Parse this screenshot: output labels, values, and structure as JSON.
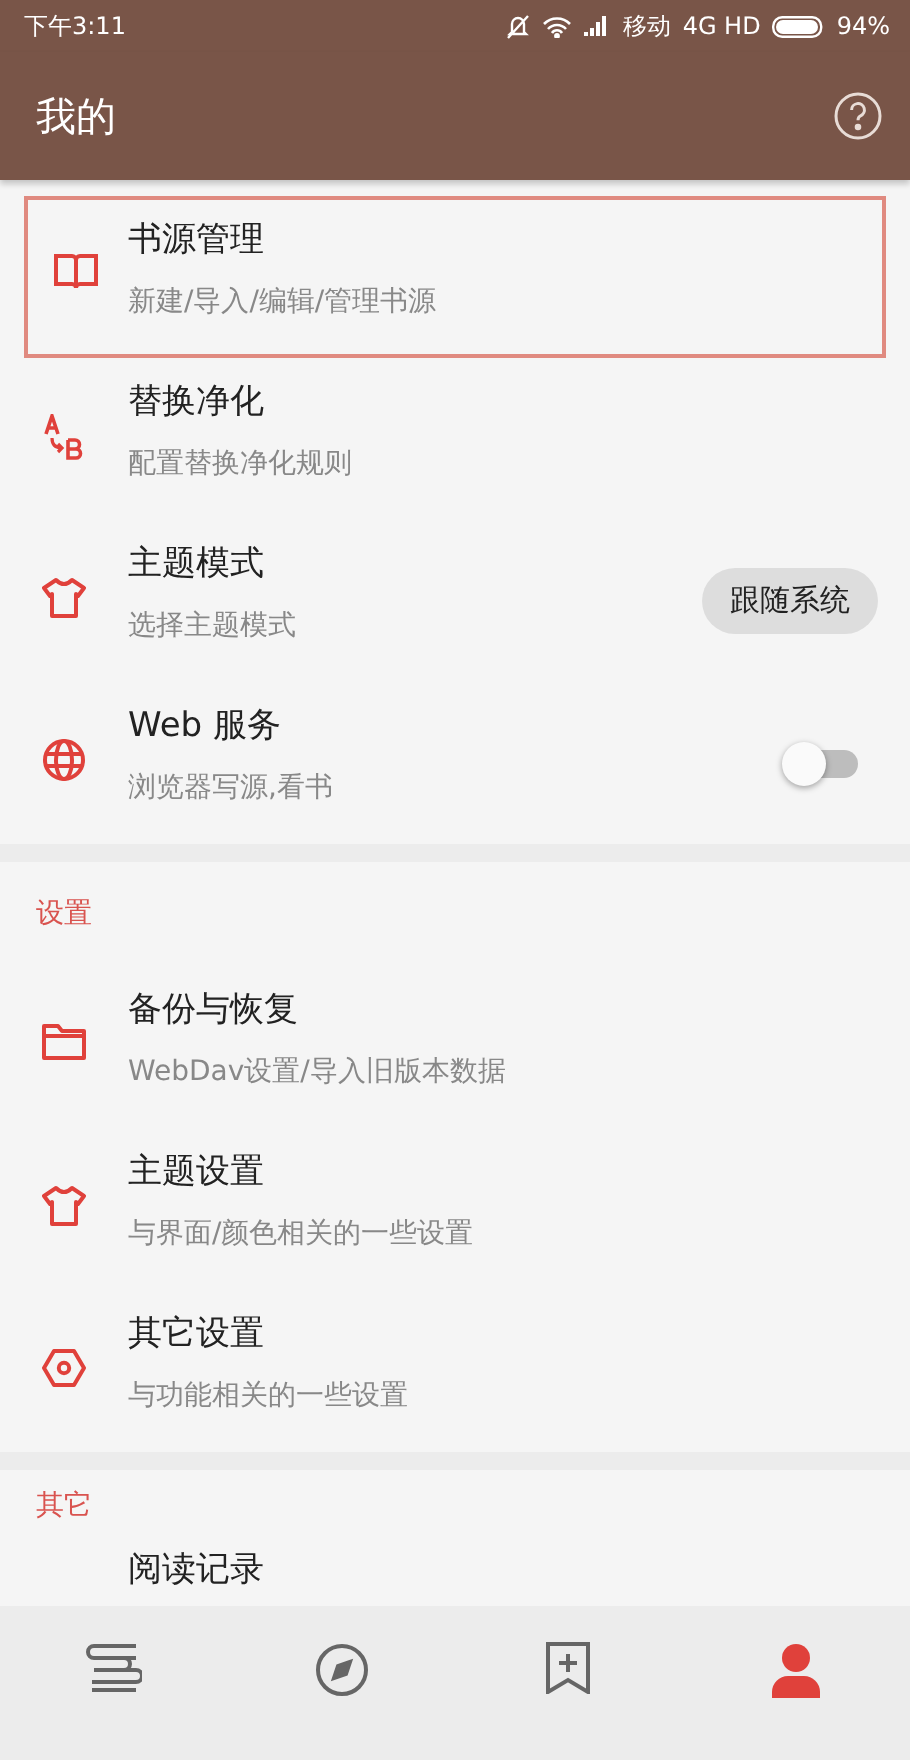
{
  "status_bar": {
    "time": "下午3:11",
    "carrier": "移动",
    "network": "4G HD",
    "battery": "94%"
  },
  "app_bar": {
    "title": "我的"
  },
  "sections": [
    {
      "items": [
        {
          "kind": "plain",
          "title": "书源管理",
          "subtitle": "新建/导入/编辑/管理书源",
          "highlighted": true
        },
        {
          "kind": "plain",
          "title": "替换净化",
          "subtitle": "配置替换净化规则",
          "highlighted": false
        },
        {
          "kind": "button",
          "title": "主题模式",
          "subtitle": "选择主题模式",
          "highlighted": false,
          "value": "跟随系统"
        },
        {
          "kind": "switch",
          "title": "Web 服务",
          "subtitle": "浏览器写源,看书",
          "highlighted": false,
          "on": false
        }
      ]
    },
    {
      "header": "设置",
      "items": [
        {
          "kind": "plain",
          "title": "备份与恢复",
          "subtitle": "WebDav设置/导入旧版本数据",
          "highlighted": false
        },
        {
          "kind": "plain",
          "title": "主题设置",
          "subtitle": "与界面/颜色相关的一些设置",
          "highlighted": false
        },
        {
          "kind": "plain",
          "title": "其它设置",
          "subtitle": "与功能相关的一些设置",
          "highlighted": false
        }
      ]
    },
    {
      "header": "其它",
      "items": [
        {
          "kind": "plain",
          "title": "阅读记录",
          "highlighted": false
        }
      ]
    }
  ],
  "bottom_nav": [
    {
      "selected": false
    },
    {
      "selected": false
    },
    {
      "selected": false
    },
    {
      "selected": true
    }
  ]
}
